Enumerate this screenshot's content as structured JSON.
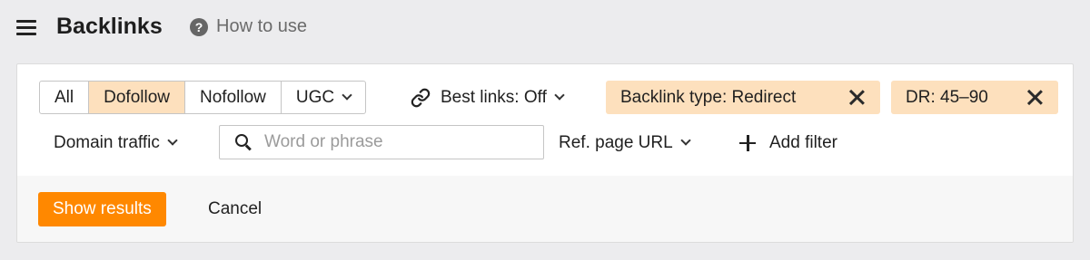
{
  "header": {
    "title": "Backlinks",
    "help_label": "How to use",
    "help_icon_glyph": "?"
  },
  "filters": {
    "link_types": [
      {
        "label": "All"
      },
      {
        "label": "Dofollow",
        "active": true
      },
      {
        "label": "Nofollow"
      },
      {
        "label": "UGC"
      }
    ],
    "best_links_label": "Best links: Off",
    "chips": [
      {
        "label": "Backlink type: Redirect"
      },
      {
        "label": "DR: 45–90"
      }
    ],
    "domain_traffic_label": "Domain traffic",
    "search": {
      "value": "",
      "placeholder": "Word or phrase"
    },
    "ref_page_url_label": "Ref. page URL",
    "add_filter_label": "Add filter"
  },
  "actions": {
    "show_results_label": "Show results",
    "cancel_label": "Cancel"
  },
  "colors": {
    "accent": "#ff8800",
    "chip_bg": "#fde0bd",
    "page_bg": "#ececee"
  },
  "icons": [
    "menu-icon",
    "help-icon",
    "chevron-down-icon",
    "link-icon",
    "close-icon",
    "search-icon",
    "plus-icon"
  ]
}
